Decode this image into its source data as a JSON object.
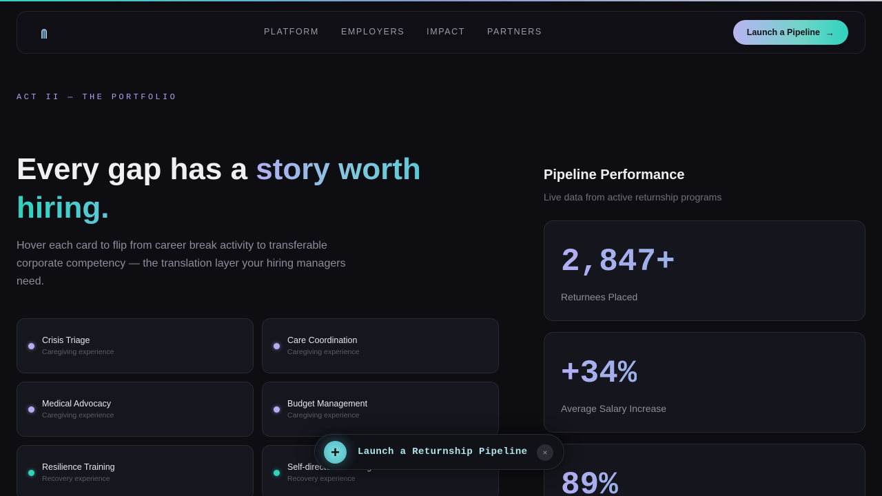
{
  "nav": {
    "links": [
      "PLATFORM",
      "EMPLOYERS",
      "IMPACT",
      "PARTNERS"
    ],
    "cta_label": "Launch a Pipeline",
    "cta_arrow": "→"
  },
  "hero": {
    "eyebrow": "ACT II — THE PORTFOLIO",
    "headline_part1": "Every gap has a ",
    "headline_part2": "story worth",
    "headline_part3": "hiring.",
    "subtitle": "Hover each card to flip from career break activity to transferable corporate competency — the translation layer your hiring managers need."
  },
  "cards": [
    {
      "title": "Crisis Triage",
      "subtitle": "Caregiving experience",
      "accent": "violet"
    },
    {
      "title": "Care Coordination",
      "subtitle": "Caregiving experience",
      "accent": "violet"
    },
    {
      "title": "Medical Advocacy",
      "subtitle": "Caregiving experience",
      "accent": "violet"
    },
    {
      "title": "Budget Management",
      "subtitle": "Caregiving experience",
      "accent": "violet"
    },
    {
      "title": "Resilience Training",
      "subtitle": "Recovery experience",
      "accent": "teal"
    },
    {
      "title": "Self-directed Learning",
      "subtitle": "Recovery experience",
      "accent": "teal"
    }
  ],
  "panel": {
    "title": "Pipeline Performance",
    "subtitle": "Live data from active returnship programs",
    "stats": [
      {
        "value": "2,847+",
        "label": "Returnees Placed"
      },
      {
        "value": "+34%",
        "label": "Average Salary Increase"
      },
      {
        "value": "89%",
        "label": ""
      }
    ]
  },
  "toast": {
    "plus_glyph": "+",
    "text": "Launch a Returnship Pipeline",
    "close_glyph": "×"
  },
  "colors": {
    "background": "#0d0d12",
    "accent_violet": "#b3aef3",
    "accent_teal": "#2fd3be"
  }
}
